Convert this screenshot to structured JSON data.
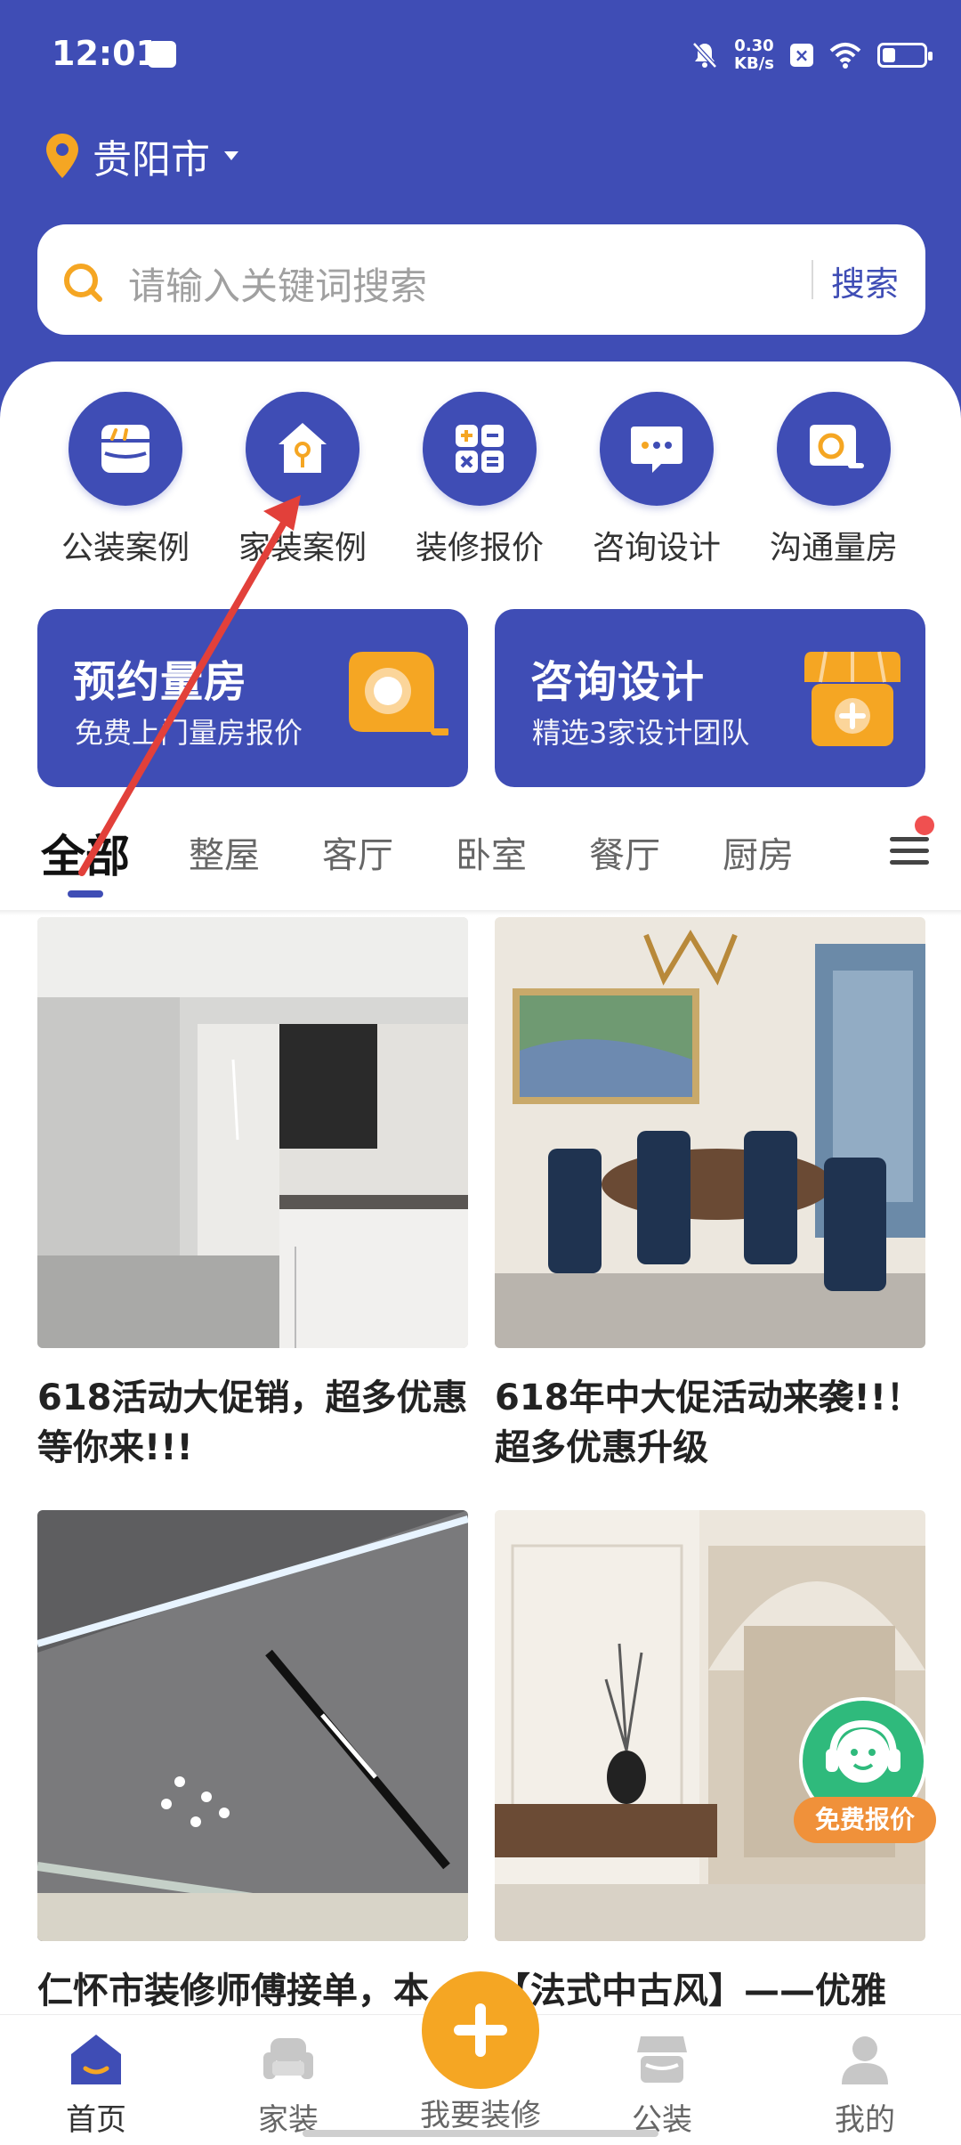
{
  "status_bar": {
    "time": "12:01",
    "speed_value": "0.30",
    "speed_unit": "KB/s"
  },
  "location": {
    "city": "贵阳市"
  },
  "search": {
    "placeholder": "请输入关键词搜索",
    "button": "搜索"
  },
  "categories": [
    {
      "label": "公装案例",
      "icon": "shop-icon"
    },
    {
      "label": "家装案例",
      "icon": "house-key-icon"
    },
    {
      "label": "装修报价",
      "icon": "calculator-icon"
    },
    {
      "label": "咨询设计",
      "icon": "chat-icon"
    },
    {
      "label": "沟通量房",
      "icon": "tape-measure-icon"
    }
  ],
  "promos": [
    {
      "title": "预约量房",
      "subtitle": "免费上门量房报价",
      "icon": "tape-measure-icon"
    },
    {
      "title": "咨询设计",
      "subtitle": "精选3家设计团队",
      "icon": "shop-plus-icon"
    }
  ],
  "tabs": [
    "全部",
    "整屋",
    "客厅",
    "卧室",
    "餐厅",
    "厨房"
  ],
  "active_tab": "全部",
  "cards": [
    {
      "title": "618活动大促销，超多优惠等你来!!!",
      "image": "modern-kitchen-hallway"
    },
    {
      "title": "618年中大促活动来袭!!！超多优惠升级",
      "image": "classic-dining-room"
    },
    {
      "title": "仁怀市装修师傅接单，本",
      "image": "ceiling-lights"
    },
    {
      "title": "【法式中古风】——优雅",
      "image": "french-vintage-living"
    }
  ],
  "float_button": {
    "label": "免费报价",
    "icon": "customer-service-icon"
  },
  "bottom_nav": {
    "items": [
      {
        "label": "首页",
        "icon": "home-icon",
        "active": true
      },
      {
        "label": "家装",
        "icon": "sofa-icon",
        "active": false
      },
      {
        "label": "我要装修",
        "icon": "plus-icon",
        "active": false
      },
      {
        "label": "公装",
        "icon": "shop-icon",
        "active": false
      },
      {
        "label": "我的",
        "icon": "user-icon",
        "active": false
      }
    ]
  },
  "colors": {
    "primary": "#3f4db5",
    "accent": "#f5a623",
    "quote_green": "#2fba7c",
    "annotation": "#e2403a"
  }
}
